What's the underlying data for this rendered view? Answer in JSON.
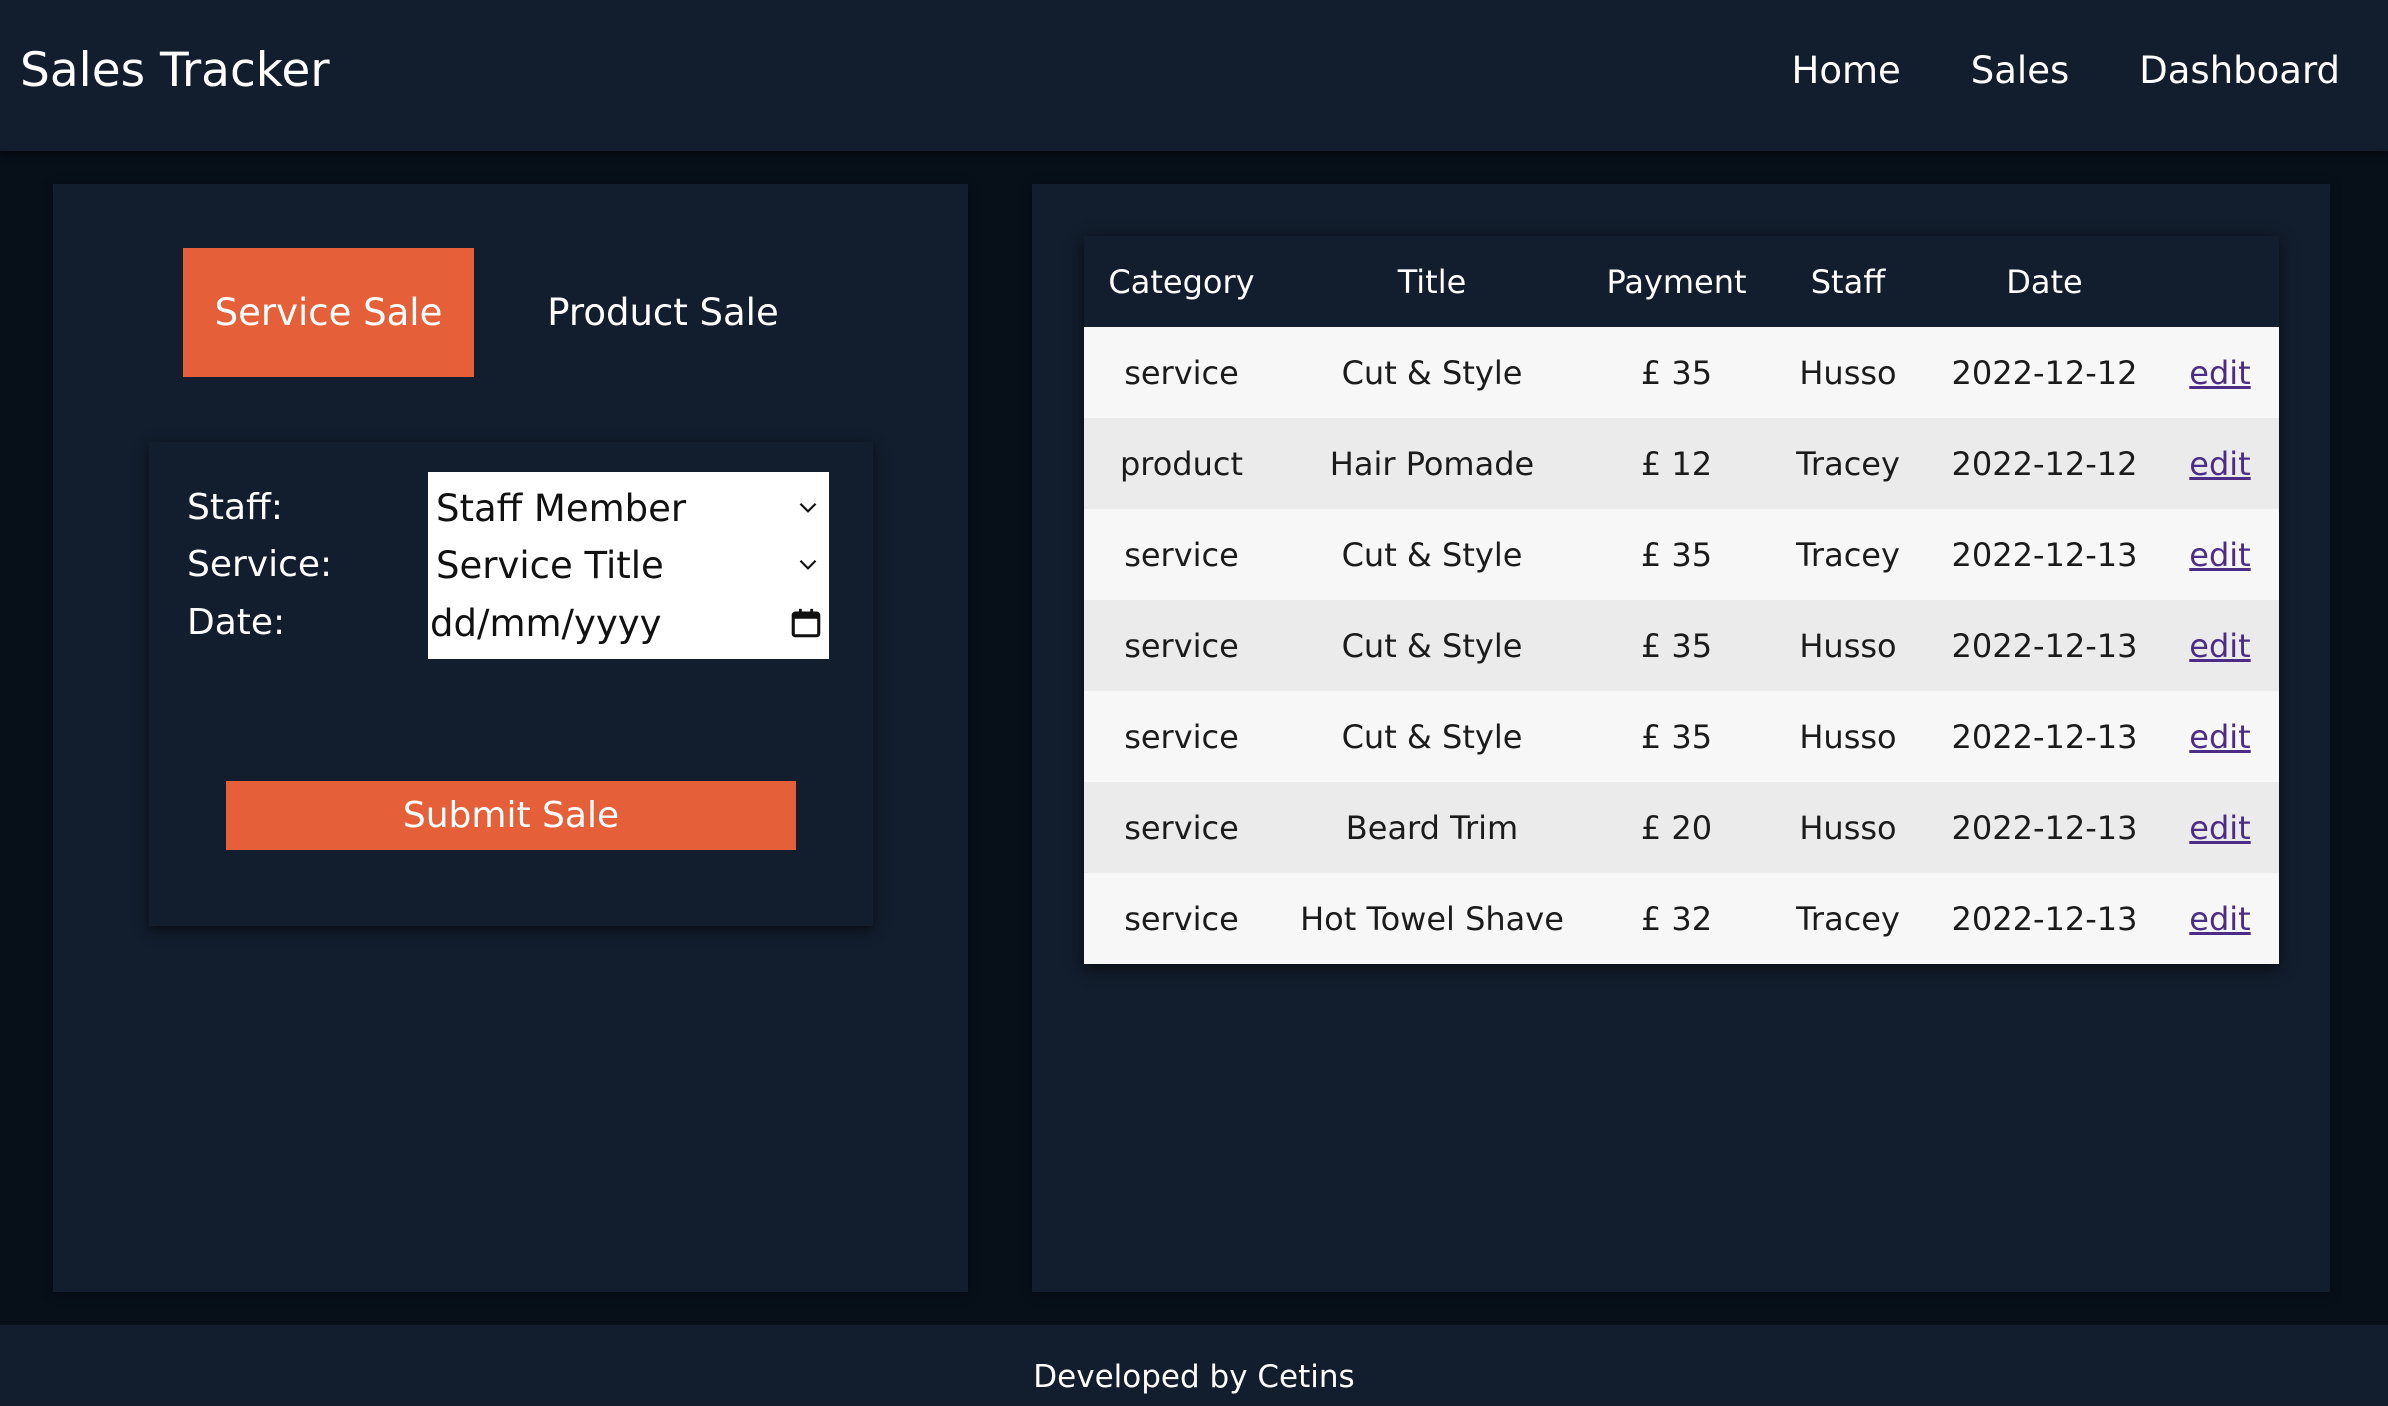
{
  "header": {
    "brand": "Sales Tracker",
    "nav": [
      "Home",
      "Sales",
      "Dashboard"
    ]
  },
  "tabs": {
    "service": "Service Sale",
    "product": "Product Sale",
    "active": "service"
  },
  "form": {
    "staff_label": "Staff:",
    "staff_value": "Staff Member",
    "service_label": "Service:",
    "service_value": "Service Title",
    "date_label": "Date:",
    "date_placeholder": "dd/mm/yyyy",
    "submit_label": "Submit Sale"
  },
  "table": {
    "headers": [
      "Category",
      "Title",
      "Payment",
      "Staff",
      "Date"
    ],
    "rows": [
      {
        "category": "service",
        "title": "Cut & Style",
        "payment": "£ 35",
        "staff": "Husso",
        "date": "2022-12-12",
        "action": "edit"
      },
      {
        "category": "product",
        "title": "Hair Pomade",
        "payment": "£ 12",
        "staff": "Tracey",
        "date": "2022-12-12",
        "action": "edit"
      },
      {
        "category": "service",
        "title": "Cut & Style",
        "payment": "£ 35",
        "staff": "Tracey",
        "date": "2022-12-13",
        "action": "edit"
      },
      {
        "category": "service",
        "title": "Cut & Style",
        "payment": "£ 35",
        "staff": "Husso",
        "date": "2022-12-13",
        "action": "edit"
      },
      {
        "category": "service",
        "title": "Cut & Style",
        "payment": "£ 35",
        "staff": "Husso",
        "date": "2022-12-13",
        "action": "edit"
      },
      {
        "category": "service",
        "title": "Beard Trim",
        "payment": "£ 20",
        "staff": "Husso",
        "date": "2022-12-13",
        "action": "edit"
      },
      {
        "category": "service",
        "title": "Hot Towel Shave",
        "payment": "£ 32",
        "staff": "Tracey",
        "date": "2022-12-13",
        "action": "edit"
      }
    ]
  },
  "footer": {
    "text": "Developed by Cetins"
  },
  "colors": {
    "accent": "#e55f39",
    "surface": "#121d2d",
    "background": "#070f19",
    "link": "#4b2c86"
  },
  "icons": {
    "select_arrow": "chevron-down-icon",
    "date_picker": "calendar-icon"
  }
}
